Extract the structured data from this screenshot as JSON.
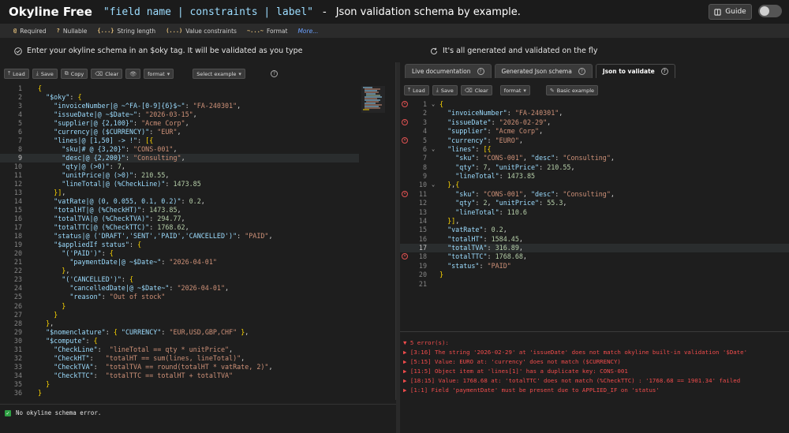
{
  "header": {
    "title": "Okyline Free",
    "code": "\"field name | constraints | label\"",
    "separator": "-",
    "description": "Json validation schema by example.",
    "guide_label": "Guide"
  },
  "legend": {
    "items": [
      {
        "symbol": "@",
        "label": "Required"
      },
      {
        "symbol": "?",
        "label": "Nullable"
      },
      {
        "symbol": "{...}",
        "label": "String length"
      },
      {
        "symbol": "(...)",
        "label": "Value constraints"
      },
      {
        "symbol": "~...~",
        "label": "Format"
      }
    ],
    "more": "More..."
  },
  "hints": {
    "left": "Enter your okyline schema in an $oky tag. It will be validated as you type",
    "right": "It's all generated and validated on the fly"
  },
  "left_toolbar": {
    "load": "Load",
    "save": "Save",
    "copy": "Copy",
    "clear": "Clear",
    "format": "format",
    "select_example": "Select example"
  },
  "right_tabs": [
    {
      "label": "Live documentation"
    },
    {
      "label": "Generated Json schema"
    },
    {
      "label": "Json to validate"
    }
  ],
  "right_toolbar": {
    "load": "Load",
    "save": "Save",
    "clear": "Clear",
    "format": "format",
    "basic_example": "Basic example"
  },
  "schema_lines": [
    "{",
    "  \"$oky\": {",
    "    \"invoiceNumber|@ ~^FA-[0-9]{6}$~\": \"FA-240301\",",
    "    \"issueDate|@ ~$Date~\": \"2026-03-15\",",
    "    \"supplier|@ {2,100}\": \"Acme Corp\",",
    "    \"currency|@ ($CURRENCY)\": \"EUR\",",
    "    \"lines|@ [1,50] -> !\": [{",
    "      \"sku|# @ {3,20}\": \"CONS-001\",",
    "      \"desc|@ {2,200}\": \"Consulting\",",
    "      \"qty|@ (>0)\": 7,",
    "      \"unitPrice|@ (>0)\": 210.55,",
    "      \"lineTotal|@ (%CheckLine)\": 1473.85",
    "    }],",
    "    \"vatRate|@ (0, 0.055, 0.1, 0.2)\": 0.2,",
    "    \"totalHT|@ (%CheckHT)\": 1473.85,",
    "    \"totalTVA|@ (%CheckTVA)\": 294.77,",
    "    \"totalTTC|@ (%CheckTTC)\": 1768.62,",
    "    \"status|@ ('DRAFT','SENT','PAID','CANCELLED')\": \"PAID\",",
    "    \"$appliedIf status\": {",
    "      \"('PAID')\": {",
    "        \"paymentDate|@ ~$Date~\": \"2026-04-01\"",
    "      },",
    "      \"('CANCELLED')\": {",
    "        \"cancelledDate|@ ~$Date~\": \"2026-04-01\",",
    "        \"reason\": \"Out of stock\"",
    "      }",
    "    }",
    "  },",
    "  \"$nomenclature\": { \"CURRENCY\": \"EUR,USD,GBP,CHF\" },",
    "  \"$compute\": {",
    "    \"CheckLine\":  \"lineTotal == qty * unitPrice\",",
    "    \"CheckHT\":   \"totalHT == sum(lines, lineTotal)\",",
    "    \"CheckTVA\":  \"totalTVA == round(totalHT * vatRate, 2)\",",
    "    \"CheckTTC\":  \"totalTTC == totalHT + totalTVA\"",
    "  }",
    "}"
  ],
  "json_lines": [
    "{",
    "  \"invoiceNumber\": \"FA-240301\",",
    "  \"issueDate\": \"2026-02-29\",",
    "  \"supplier\": \"Acme Corp\",",
    "  \"currency\": \"EURO\",",
    "  \"lines\": [{",
    "    \"sku\": \"CONS-001\", \"desc\": \"Consulting\",",
    "    \"qty\": 7, \"unitPrice\": 210.55,",
    "    \"lineTotal\": 1473.85",
    "  },{",
    "    \"sku\": \"CONS-001\", \"desc\": \"Consulting\",",
    "    \"qty\": 2, \"unitPrice\": 55.3,",
    "    \"lineTotal\": 110.6",
    "  }],",
    "  \"vatRate\": 0.2,",
    "  \"totalHT\": 1584.45,",
    "  \"totalTVA\": 316.89,",
    "  \"totalTTC\": 1768.68,",
    "  \"status\": \"PAID\"",
    "}",
    ""
  ],
  "json_error_lines": [
    1,
    3,
    5,
    11,
    18
  ],
  "status": {
    "schema_ok": "No okyline schema error."
  },
  "errors": {
    "header": "5 error(s):",
    "items": [
      "[3:16] The string '2026-02-29' at 'issueDate' does not match okyline built-in validation '$Date'",
      "[5:15] Value: EURO at: 'currency' does not match ($CURRENCY)",
      "[11:5] Object item at 'lines[1]' has a duplicate key: CONS-001",
      "[18:15] Value: 1768.68 at: 'totalTTC' does not match (%CheckTTC) : '1768.68 == 1901.34' failed",
      "[1:1] Field 'paymentDate' must be present due to APPLIED_IF on 'status'"
    ]
  }
}
